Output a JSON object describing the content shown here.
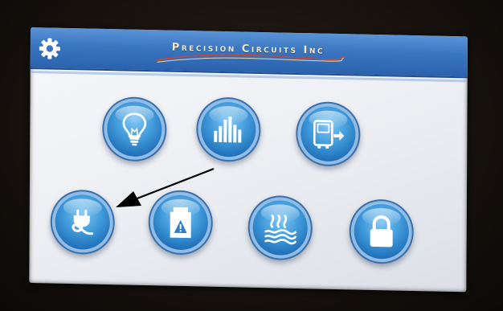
{
  "header": {
    "brand_name": "Precision Circuits Inc"
  },
  "icons": {
    "settings": "gear-icon",
    "row1": [
      "lightbulb-icon",
      "bar-chart-icon",
      "transfer-icon"
    ],
    "row2": [
      "power-plug-icon",
      "warning-icon",
      "heat-waves-icon",
      "lock-icon"
    ]
  },
  "colors": {
    "header_blue": "#3a75c0",
    "button_blue": "#3d97d8",
    "screen_bg": "#eef0f4",
    "brand_text": "#f2e6c3",
    "swoosh_red": "#c44a3a"
  }
}
